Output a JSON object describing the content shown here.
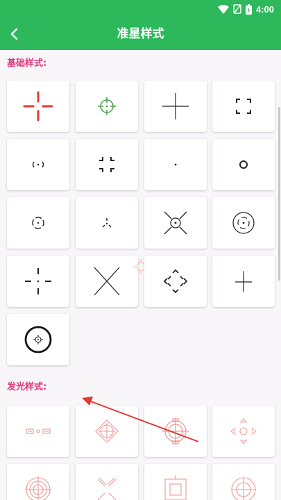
{
  "status_bar": {
    "time": "4:00",
    "wifi_icon": "wifi-icon",
    "signal_icon": "no-signal-icon",
    "battery_icon": "battery-icon"
  },
  "toolbar": {
    "title": "准星样式",
    "back_icon": "chevron-left-icon",
    "background": "#2db85b"
  },
  "sections": {
    "basic": {
      "title": "基础样式:"
    },
    "glow": {
      "title": "发光样式:"
    }
  },
  "basic_styles": [
    {
      "icon": "red-cross-crosshair-icon"
    },
    {
      "icon": "green-circle-crosshair-icon"
    },
    {
      "icon": "thin-cross-crosshair-icon"
    },
    {
      "icon": "corner-brackets-crosshair-icon"
    },
    {
      "icon": "parentheses-dot-crosshair-icon"
    },
    {
      "icon": "corner-ticks-crosshair-icon"
    },
    {
      "icon": "dot-crosshair-icon"
    },
    {
      "icon": "small-circle-crosshair-icon"
    },
    {
      "icon": "dashed-circle-crosshair-icon"
    },
    {
      "icon": "tri-dot-crosshair-icon"
    },
    {
      "icon": "x-circle-crosshair-icon"
    },
    {
      "icon": "concentric-circle-crosshair-icon"
    },
    {
      "icon": "dashed-cross-crosshair-icon"
    },
    {
      "icon": "big-x-crosshair-icon"
    },
    {
      "icon": "diamond-chevrons-crosshair-icon"
    },
    {
      "icon": "tall-cross-crosshair-icon"
    },
    {
      "icon": "bold-circle-crosshair-icon"
    }
  ],
  "glow_styles": [
    {
      "icon": "glow-bars-crosshair-icon"
    },
    {
      "icon": "glow-diamond-crosshair-icon"
    },
    {
      "icon": "glow-circle-crosshair-icon"
    },
    {
      "icon": "glow-arrows-crosshair-icon"
    },
    {
      "icon": "glow-rings-crosshair-icon"
    },
    {
      "icon": "glow-x-crosshair-icon"
    },
    {
      "icon": "glow-square-crosshair-icon"
    },
    {
      "icon": "glow-target-crosshair-icon"
    }
  ],
  "colors": {
    "accent": "#2db85b",
    "section_title": "#e4367b",
    "arrow": "#e53935",
    "glow": "#f08a8a"
  }
}
